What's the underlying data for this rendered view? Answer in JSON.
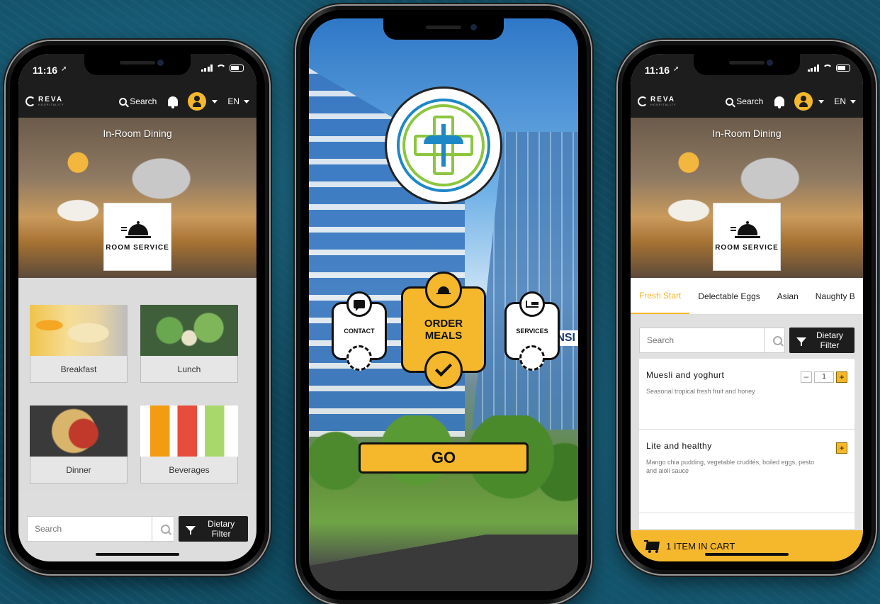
{
  "status": {
    "time": "11:16",
    "location_icon": "location-arrow-icon"
  },
  "nav": {
    "brand": "REVA",
    "brand_sub": "HOSPITALITY",
    "search_label": "Search",
    "language": "EN"
  },
  "hero": {
    "title": "In-Room Dining",
    "card_label": "ROOM SERVICE"
  },
  "menu_categories": [
    {
      "label": "Breakfast"
    },
    {
      "label": "Lunch"
    },
    {
      "label": "Dinner"
    },
    {
      "label": "Beverages"
    }
  ],
  "search": {
    "placeholder": "Search",
    "filter_label": "Dietary Filter"
  },
  "landing": {
    "contact_label": "CONTACT",
    "order_label_1": "ORDER",
    "order_label_2": "MEALS",
    "services_label": "SERVICES",
    "go_label": "GO",
    "sign_text": "NSI"
  },
  "tabs": [
    {
      "label": "Fresh Start",
      "active": true
    },
    {
      "label": "Delectable Eggs",
      "active": false
    },
    {
      "label": "Asian",
      "active": false
    },
    {
      "label": "Naughty B",
      "active": false
    }
  ],
  "items": [
    {
      "title": "Muesli and yoghurt",
      "description": "Seasonal tropical fresh fruit and honey",
      "quantity": "1",
      "minus": "–",
      "plus": "+"
    },
    {
      "title": "Lite and healthy",
      "description": "Mango chia pudding, vegetable crudités, boiled eggs, pesto and aioli sauce",
      "plus": "+"
    }
  ],
  "cart": {
    "label": "1 ITEM IN CART"
  },
  "colors": {
    "accent": "#f5b72c",
    "nav_bg": "#1d1d1d",
    "brand_blue": "#1e88c7",
    "brand_green": "#8cc63f"
  }
}
